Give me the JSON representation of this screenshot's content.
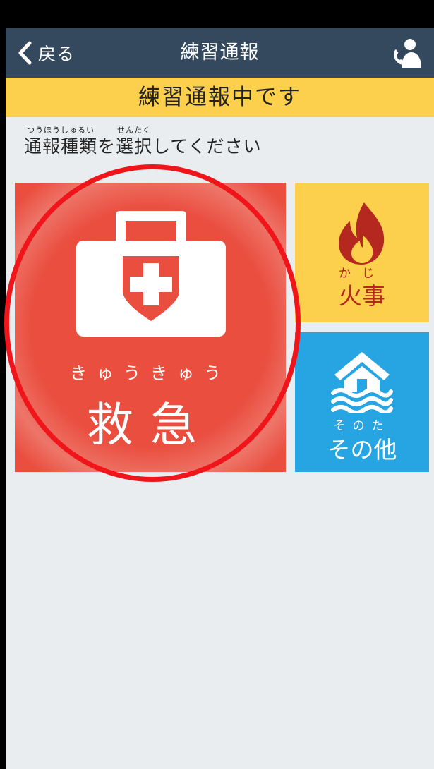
{
  "nav": {
    "back_label": "戻る",
    "title": "練習通報"
  },
  "banner": {
    "text": "練習通報中です"
  },
  "instruction": {
    "segments": [
      {
        "ruby": "つうほうしゅるい",
        "text": "通報種類"
      },
      {
        "ruby": "",
        "text": "を"
      },
      {
        "ruby": "せんたく",
        "text": "選択"
      },
      {
        "ruby": "",
        "text": "してください"
      }
    ]
  },
  "tiles": {
    "emergency": {
      "ruby": "きゅうきゅう",
      "label": "救急",
      "icon": "first-aid-kit-icon",
      "color": "#ea4e3f"
    },
    "fire": {
      "ruby": "かじ",
      "label": "火事",
      "icon": "flame-icon",
      "color": "#fcd04c"
    },
    "other": {
      "ruby": "そのた",
      "label": "その他",
      "icon": "house-flood-icon",
      "color": "#27a4e2"
    }
  },
  "colors": {
    "navbar": "#34495e",
    "banner": "#fcd04c",
    "background": "#eaedf0",
    "highlight_circle": "#f0151a"
  }
}
